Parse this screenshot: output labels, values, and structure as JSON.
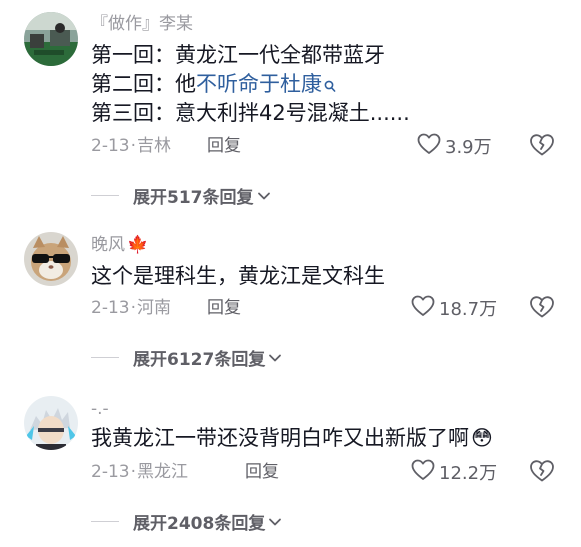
{
  "comments": [
    {
      "username": "『做作』李某",
      "content_lines": [
        "第一回：黄龙江一代全都带蓝牙",
        "第二回：他",
        "第三回：意大利拌42号混凝土......"
      ],
      "link_text": "不听命于杜康",
      "date": "2-13",
      "location": "吉林",
      "reply_label": "回复",
      "likes": "3.9万",
      "expand_label": "展开517条回复"
    },
    {
      "username": "晚风",
      "username_emoji": "🍁",
      "content_lines": [
        "这个是理科生，黄龙江是文科生"
      ],
      "date": "2-13",
      "location": "河南",
      "reply_label": "回复",
      "likes": "18.7万",
      "expand_label": "展开6127条回复"
    },
    {
      "username": "-.-",
      "content_lines": [
        "我黄龙江一带还没背明白咋又出新版了啊"
      ],
      "content_emoji": "😳",
      "date": "2-13",
      "location": "黑龙江",
      "reply_label": "回复",
      "likes": "12.2万",
      "expand_label": "展开2408条回复"
    }
  ],
  "icons": {
    "like": "heart-outline-icon",
    "dislike": "broken-heart-icon",
    "expand": "chevron-down-icon",
    "search": "search-icon"
  },
  "colors": {
    "primary_text": "#161823",
    "secondary_text": "#9a9aa0",
    "link": "#2f5f9e",
    "action_text": "#5f5f66"
  }
}
